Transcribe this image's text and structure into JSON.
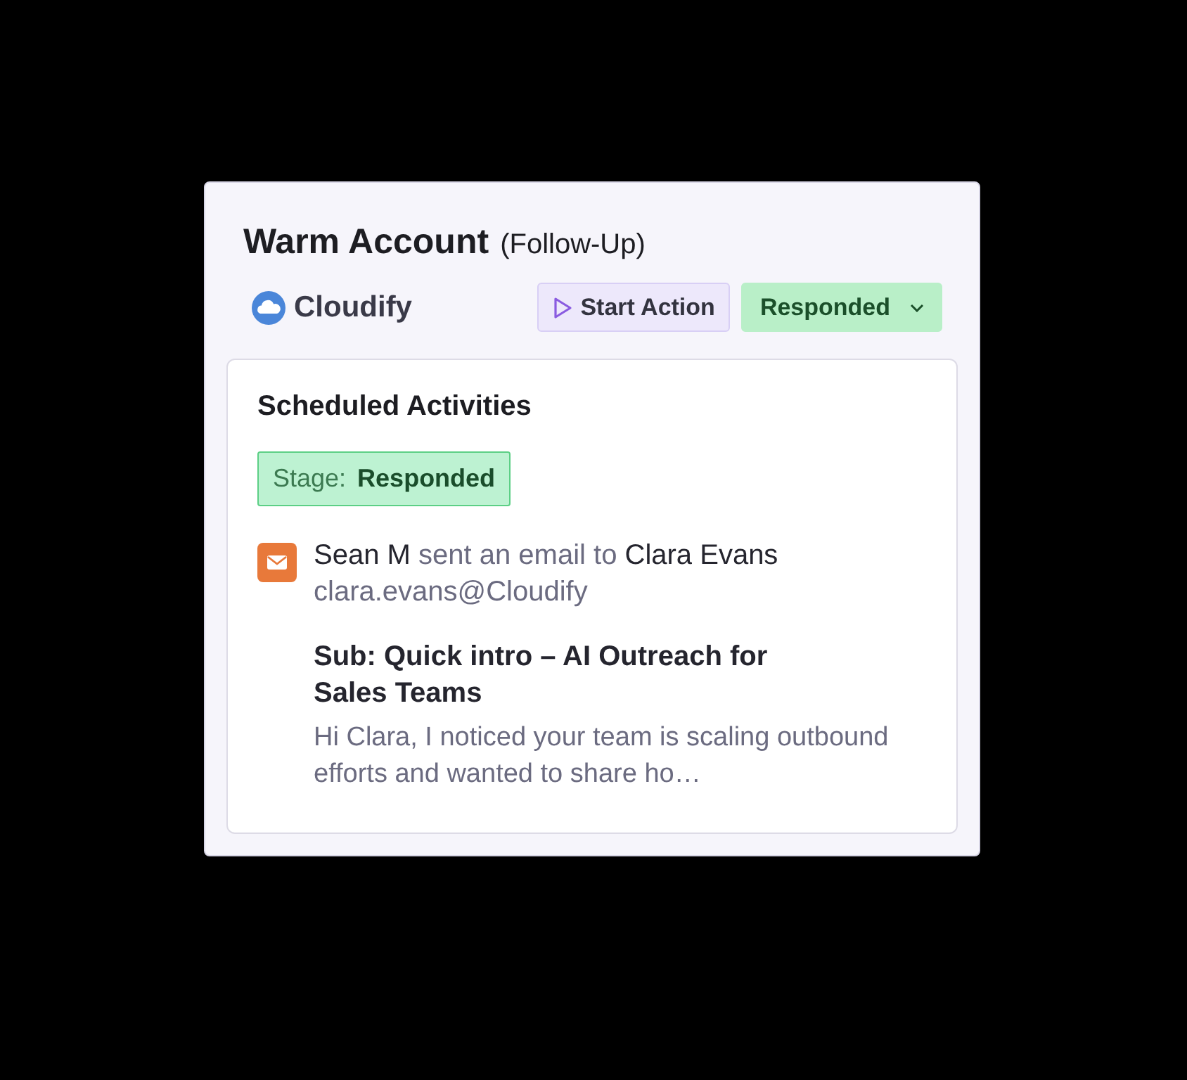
{
  "card": {
    "title": "Warm Account",
    "subtitle": "(Follow-Up)",
    "company": "Cloudify",
    "buttons": [
      {
        "kind": "action",
        "label": "Start Action"
      },
      {
        "kind": "status",
        "label": "Responded"
      }
    ]
  },
  "activities": {
    "title": "Scheduled Activities",
    "stage": {
      "label": "Stage:",
      "value": "Responded"
    },
    "items": [
      {
        "kind": "email",
        "summary": "**Sean M** sent an email to **Clara Evans**",
        "address": "clara.evans@Cloudify",
        "subject": "Sub: Quick intro – AI Outreach for Sales Teams",
        "preview": "Hi Clara, I noticed your team is scaling outbound efforts and wanted to share ho…"
      }
    ]
  }
}
